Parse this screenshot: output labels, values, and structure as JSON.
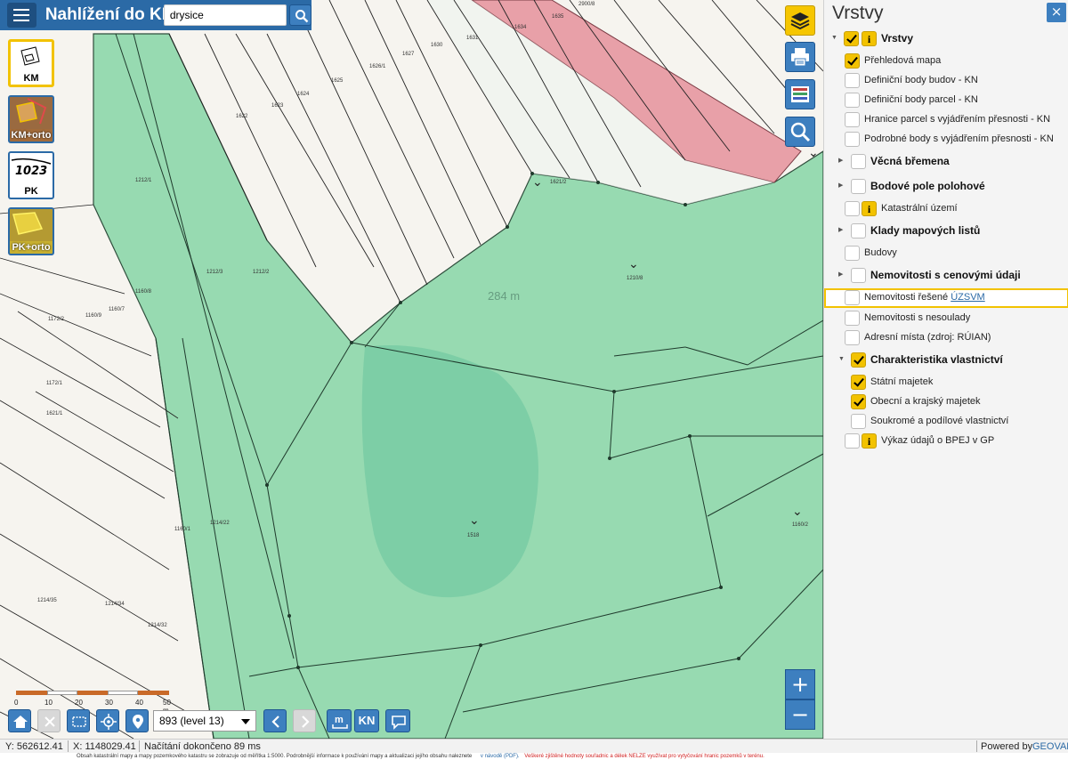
{
  "app": {
    "title": "Nahlížení do KN"
  },
  "search": {
    "value": "drysice"
  },
  "map_types": [
    {
      "label": "KM"
    },
    {
      "label": "KM+orto"
    },
    {
      "label": "PK"
    },
    {
      "label": "PK+orto"
    }
  ],
  "map": {
    "distance_label": "284 m",
    "parcels": [
      "1635",
      "2900/8",
      "1634",
      "1631",
      "1630",
      "1627",
      "1626/1",
      "1625",
      "1624",
      "1623",
      "1622",
      "1621/2",
      "1212/1",
      "1212/3",
      "1212/2",
      "1160/8",
      "1160/7",
      "1160/9",
      "1172/2",
      "1172/1",
      "1621/1",
      "1210/8",
      "1518",
      "1160/2",
      "1160/1",
      "1214/22",
      "1214/35",
      "1214/34",
      "1214/32"
    ]
  },
  "scalebar": {
    "ticks": [
      "0",
      "10",
      "20",
      "30",
      "40",
      "50 m"
    ]
  },
  "toolbar": {
    "level": "893 (level 13)",
    "kn_label": "KN"
  },
  "status": {
    "y": "Y: 562612.41",
    "x": "X: 1148029.41",
    "loaded": "Načítání dokončeno 89 ms",
    "powered": "Powered by",
    "brand": "GEOVAP",
    "info_line_1": "Obsah katastrální mapy a mapy pozemkového katastru se zobrazuje od měřítka 1:5000. Podrobnější informace k používání mapy a aktualizaci jejího obsahu naleznete",
    "info_line_2": "v návodě (PDF).",
    "info_line_3": "Veškeré zjištěné hodnoty souřadnic a délek NELZE využívat pro vytyčování hranic pozemků v terénu."
  },
  "panel": {
    "title": "Vrstvy",
    "close": "×",
    "items": [
      {
        "label": "Vrstvy",
        "level": 0,
        "bold": true,
        "checked": true,
        "info": true,
        "expander": "down"
      },
      {
        "label": "Přehledová mapa",
        "level": 1,
        "checked": true
      },
      {
        "label": "Definiční body budov - KN",
        "level": 1,
        "checked": false
      },
      {
        "label": "Definiční body parcel - KN",
        "level": 1,
        "checked": false
      },
      {
        "label": "Hranice parcel s vyjádřením přesnosti - KN",
        "level": 1,
        "checked": false
      },
      {
        "label": "Podrobné body s vyjádřením přesnosti - KN",
        "level": 1,
        "checked": false
      },
      {
        "label": "Věcná břemena",
        "level": 0,
        "bold": true,
        "checked": false,
        "expander": "right"
      },
      {
        "label": "Bodové pole polohové",
        "level": 0,
        "bold": true,
        "checked": false,
        "expander": "right"
      },
      {
        "label": "Katastrální území",
        "level": 1,
        "checked": false,
        "info": true
      },
      {
        "label": "Klady mapových listů",
        "level": 0,
        "bold": true,
        "checked": false,
        "expander": "right"
      },
      {
        "label": "Budovy",
        "level": 1,
        "checked": false
      },
      {
        "label": "Nemovitosti s cenovými údaji",
        "level": 0,
        "bold": true,
        "checked": false,
        "expander": "right"
      },
      {
        "label": "Nemovitosti řešené",
        "link": "ÚZSVM",
        "level": 1,
        "checked": false,
        "highlight": true
      },
      {
        "label": "Nemovitosti s nesoulady",
        "level": 1,
        "checked": false
      },
      {
        "label": "Adresní místa (zdroj: RÚIAN)",
        "level": 1,
        "checked": false
      },
      {
        "label": "Charakteristika vlastnictví",
        "level": 0,
        "bold": true,
        "checked": true,
        "expander": "down"
      },
      {
        "label": "Státní majetek",
        "level": 1,
        "checked": true
      },
      {
        "label": "Obecní a krajský majetek",
        "level": 1,
        "checked": true
      },
      {
        "label": "Soukromé a podílové vlastnictví",
        "level": 1,
        "checked": false
      },
      {
        "label": "Výkaz údajů o BPEJ v GP",
        "level": 1,
        "checked": false,
        "info": true
      }
    ]
  },
  "colors": {
    "brand_blue": "#2b6aa6",
    "accent_yellow": "#f2c200",
    "state_green": "#8fd8ac",
    "municipal_red": "#e8a0a8"
  }
}
